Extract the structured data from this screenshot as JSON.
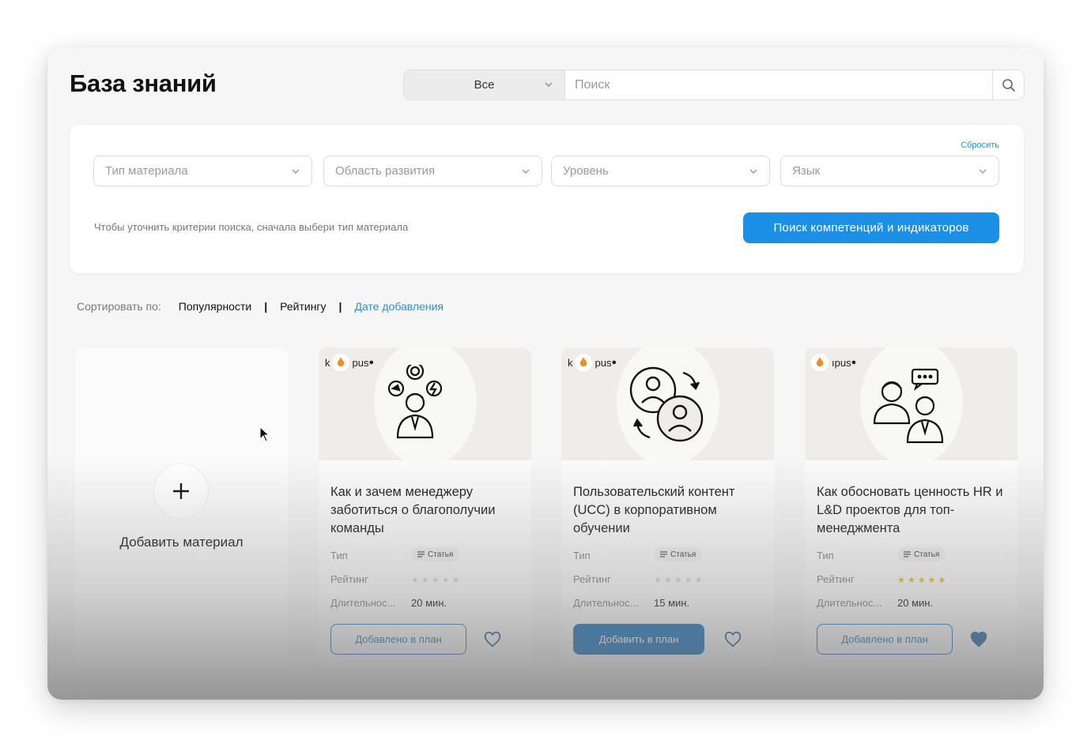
{
  "header": {
    "title": "База знаний",
    "scope_value": "Все",
    "search_placeholder": "Поиск"
  },
  "filters": {
    "reset_label": "Сбросить",
    "items": [
      {
        "placeholder": "Тип материала"
      },
      {
        "placeholder": "Область развития"
      },
      {
        "placeholder": "Уровень"
      },
      {
        "placeholder": "Язык"
      }
    ],
    "hint": "Чтобы уточнить критерии поиска, сначала выбери тип материала",
    "search_button": "Поиск компетенций и индикаторов"
  },
  "sort": {
    "label": "Сортировать по:",
    "options": [
      "Популярности",
      "Рейтингу",
      "Дате добавления"
    ],
    "separators": [
      "|",
      "|"
    ],
    "active": "Дате добавления"
  },
  "add_card": {
    "label": "Добавить материал",
    "icon": "plus-icon"
  },
  "cards": [
    {
      "logo_text": "pus",
      "logo_prefix": "k",
      "title": "Как и зачем менеджеру заботиться о благополучии команды",
      "type_label": "Тип",
      "type_value": "Статья",
      "rating_label": "Рейтинг",
      "rating": 0,
      "duration_label": "Длительнос...",
      "duration_value": "20 мин.",
      "button_label": "Добавлено в план",
      "in_plan": true,
      "favorite": false
    },
    {
      "logo_text": "pus",
      "logo_prefix": "k",
      "title": "Пользовательский контент (UCC) в корпоративном обучении",
      "type_label": "Тип",
      "type_value": "Статья",
      "rating_label": "Рейтинг",
      "rating": 0,
      "duration_label": "Длительнос...",
      "duration_value": "15 мин.",
      "button_label": "Добавить в план",
      "in_plan": false,
      "favorite": false
    },
    {
      "logo_text": "ıpus",
      "logo_prefix": "",
      "title": "Как обосновать ценность HR и L&D проектов для топ-менеджмента",
      "type_label": "Тип",
      "type_value": "Статья",
      "rating_label": "Рейтинг",
      "rating": 5,
      "duration_label": "Длительнос...",
      "duration_value": "20 мин.",
      "button_label": "Добавлено в план",
      "in_plan": true,
      "favorite": true
    }
  ],
  "colors": {
    "accent": "#1c8fe6",
    "button_dark": "#2278c0",
    "link": "#2f8fc6",
    "star_on": "#f2b81b",
    "star_off": "#d6d6d6"
  }
}
